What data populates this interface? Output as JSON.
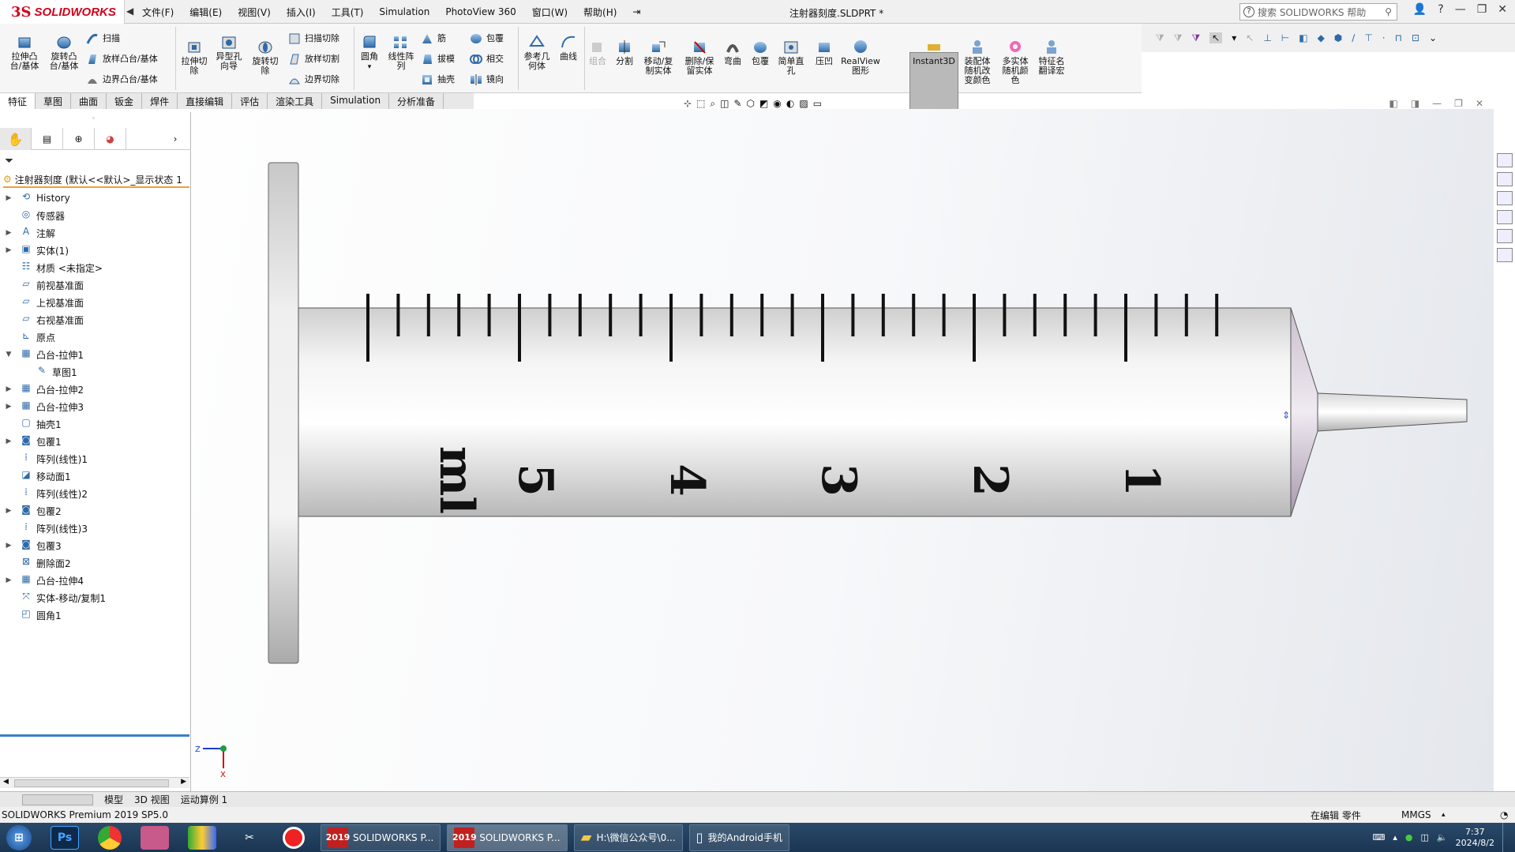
{
  "app": {
    "brand_ds": "3S",
    "brand_name": "SOLIDWORKS",
    "doc_title": "注射器刻度.SLDPRT *",
    "menus": [
      "文件(F)",
      "编辑(E)",
      "视图(V)",
      "插入(I)",
      "工具(T)",
      "Simulation",
      "PhotoView 360",
      "窗口(W)",
      "帮助(H)"
    ],
    "search_placeholder": "搜索 SOLIDWORKS 帮助"
  },
  "commands": {
    "extrude_boss": "拉伸凸\n台/基体",
    "revolve_boss": "旋转凸\n台/基体",
    "sweep": "扫描",
    "loft": "放样凸台/基体",
    "boundary": "边界凸台/基体",
    "extrude_cut": "拉伸切\n除",
    "hole_wizard": "异型孔\n向导",
    "revolve_cut": "旋转切\n除",
    "sweep_cut": "扫描切除",
    "loft_cut": "放样切割",
    "boundary_cut": "边界切除",
    "fillet": "圆角",
    "linear_pattern": "线性阵\n列",
    "rib": "筋",
    "draft": "拔模",
    "shell": "抽壳",
    "wrap": "包覆",
    "intersect": "相交",
    "mirror": "镜向",
    "ref_geometry": "参考几\n何体",
    "curves": "曲线",
    "combine": "组合",
    "split": "分割",
    "move_copy": "移动/复\n制实体",
    "delete_keep": "删除/保\n留实体",
    "flex": "弯曲",
    "wrap2": "包覆",
    "simple_hole": "简单直\n孔",
    "indent": "压凹",
    "realview": "RealView\n图形",
    "instant3d": "Instant3D",
    "assembly_color": "装配体\n随机改\n变颜色",
    "multibody_color": "多实体\n随机颜\n色",
    "feature_rename": "特征名\n翻译宏"
  },
  "tabs": [
    "特征",
    "草图",
    "曲面",
    "钣金",
    "焊件",
    "直接编辑",
    "评估",
    "渲染工具",
    "Simulation",
    "分析准备"
  ],
  "feature_manager": {
    "root": "注射器刻度 (默认<<默认>_显示状态 1",
    "tree": [
      {
        "label": "History",
        "expand": "▶",
        "icon": "history-icon",
        "child": false
      },
      {
        "label": "传感器",
        "expand": "",
        "icon": "sensor-icon",
        "child": false
      },
      {
        "label": "注解",
        "expand": "▶",
        "icon": "annotation-icon",
        "child": false
      },
      {
        "label": "实体(1)",
        "expand": "▶",
        "icon": "solid-bodies-icon",
        "child": false
      },
      {
        "label": "材质 <未指定>",
        "expand": "",
        "icon": "material-icon",
        "child": false
      },
      {
        "label": "前视基准面",
        "expand": "",
        "icon": "plane-icon",
        "child": false
      },
      {
        "label": "上视基准面",
        "expand": "",
        "icon": "plane-icon",
        "child": false
      },
      {
        "label": "右视基准面",
        "expand": "",
        "icon": "plane-icon",
        "child": false
      },
      {
        "label": "原点",
        "expand": "",
        "icon": "origin-icon",
        "child": false
      },
      {
        "label": "凸台-拉伸1",
        "expand": "▼",
        "icon": "extrude-icon",
        "child": false
      },
      {
        "label": "草图1",
        "expand": "",
        "icon": "sketch-icon",
        "child": true
      },
      {
        "label": "凸台-拉伸2",
        "expand": "▶",
        "icon": "extrude-icon",
        "child": false
      },
      {
        "label": "凸台-拉伸3",
        "expand": "▶",
        "icon": "extrude-icon",
        "child": false
      },
      {
        "label": "抽壳1",
        "expand": "",
        "icon": "shell-icon",
        "child": false
      },
      {
        "label": "包覆1",
        "expand": "▶",
        "icon": "wrap-icon",
        "child": false
      },
      {
        "label": "阵列(线性)1",
        "expand": "",
        "icon": "pattern-icon",
        "child": false
      },
      {
        "label": "移动面1",
        "expand": "",
        "icon": "move-face-icon",
        "child": false
      },
      {
        "label": "阵列(线性)2",
        "expand": "",
        "icon": "pattern-icon",
        "child": false
      },
      {
        "label": "包覆2",
        "expand": "▶",
        "icon": "wrap-icon",
        "child": false
      },
      {
        "label": "阵列(线性)3",
        "expand": "",
        "icon": "pattern-icon",
        "child": false
      },
      {
        "label": "包覆3",
        "expand": "▶",
        "icon": "wrap-icon",
        "child": false
      },
      {
        "label": "删除面2",
        "expand": "",
        "icon": "delete-face-icon",
        "child": false
      },
      {
        "label": "凸台-拉伸4",
        "expand": "▶",
        "icon": "extrude-icon",
        "child": false
      },
      {
        "label": "实体-移动/复制1",
        "expand": "",
        "icon": "move-body-icon",
        "child": false
      },
      {
        "label": "圆角1",
        "expand": "",
        "icon": "fillet-icon",
        "child": false
      }
    ]
  },
  "viewport": {
    "scale_numbers": [
      "1",
      "2",
      "3",
      "4",
      "5"
    ],
    "unit_label": "ml",
    "triad_x": "X",
    "triad_z": "Z"
  },
  "model_tabs": [
    "模型",
    "3D 视图",
    "运动算例 1"
  ],
  "status": {
    "version": "SOLIDWORKS Premium 2019 SP5.0",
    "mode": "在编辑 零件",
    "units": "MMGS"
  },
  "taskbar": {
    "tasks": [
      "SOLIDWORKS P...",
      "SOLIDWORKS P...",
      "H:\\微信公众号\\0...",
      "我的Android手机"
    ],
    "sw_year": "2019",
    "time": "7:37",
    "date": "2024/8/2"
  },
  "colors": {
    "brand_red": "#d0021b",
    "barrel_gray": "#d6d6d6",
    "tip_purple": "#b8a8c0"
  }
}
